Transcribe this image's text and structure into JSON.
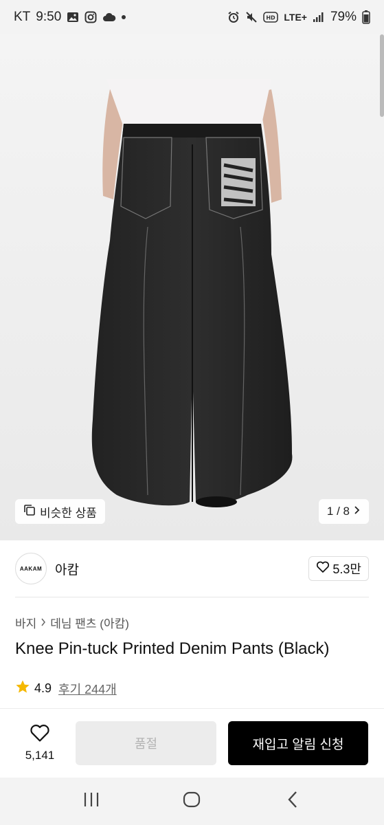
{
  "status_bar": {
    "carrier": "KT",
    "time": "9:50",
    "network": "LTE+",
    "battery": "79%"
  },
  "hero": {
    "similar_label": "비슷한 상품",
    "page_indicator": "1 / 8",
    "print_text": "AAKAM"
  },
  "brand": {
    "logo_text": "AAKAM",
    "name": "아캄",
    "likes": "5.3만"
  },
  "breadcrumb": {
    "category": "바지",
    "subcategory": "데님 팬츠 (아캄)"
  },
  "product": {
    "title": "Knee Pin-tuck Printed Denim Pants (Black)",
    "rating": "4.9",
    "reviews": "후기 244개"
  },
  "action_bar": {
    "wish_count": "5,141",
    "soldout_label": "품절",
    "restock_label": "재입고 알림 신청"
  },
  "colors": {
    "accent_star": "#F5B800",
    "primary_button": "#000000",
    "disabled_button": "#ECECEC"
  },
  "icons": [
    "image-icon",
    "instagram-icon",
    "cloud-icon",
    "alarm-icon",
    "mute-icon",
    "hd-icon",
    "signal-icon",
    "battery-icon",
    "similar-icon",
    "chevron-right-icon",
    "heart-icon",
    "star-icon",
    "recents-icon",
    "home-icon",
    "back-icon"
  ]
}
